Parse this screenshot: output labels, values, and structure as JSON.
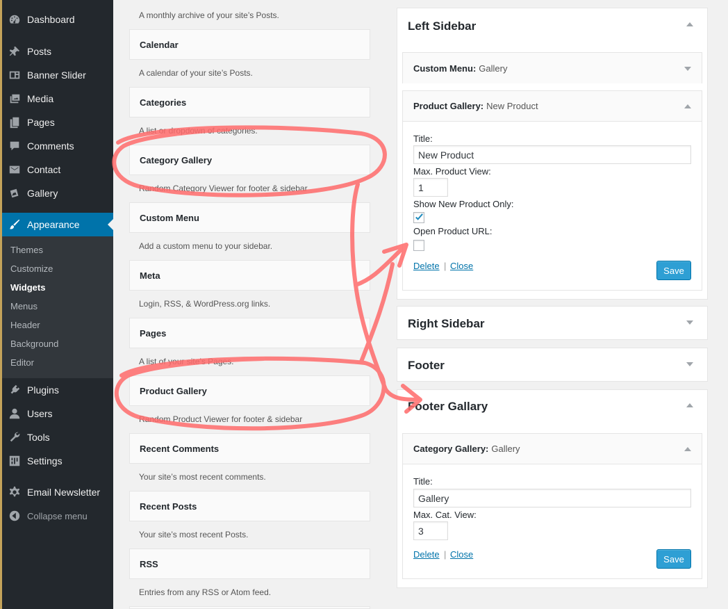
{
  "admin_menu": {
    "top_items": [
      {
        "label": "Dashboard",
        "icon": "dashboard-icon"
      },
      {
        "label": "Posts",
        "icon": "pin-icon"
      },
      {
        "label": "Banner Slider",
        "icon": "slider-icon"
      },
      {
        "label": "Media",
        "icon": "media-icon"
      },
      {
        "label": "Pages",
        "icon": "pages-icon"
      },
      {
        "label": "Comments",
        "icon": "comment-icon"
      },
      {
        "label": "Contact",
        "icon": "mail-icon"
      },
      {
        "label": "Gallery",
        "icon": "gallery-icon"
      }
    ],
    "current": {
      "label": "Appearance",
      "icon": "brush-icon"
    },
    "submenu": [
      "Themes",
      "Customize",
      "Widgets",
      "Menus",
      "Header",
      "Background",
      "Editor"
    ],
    "active_submenu": "Widgets",
    "bottom_items": [
      {
        "label": "Plugins",
        "icon": "plug-icon"
      },
      {
        "label": "Users",
        "icon": "user-icon"
      },
      {
        "label": "Tools",
        "icon": "wrench-icon"
      },
      {
        "label": "Settings",
        "icon": "settings-icon"
      }
    ],
    "extra_item": {
      "label": "Email Newsletter",
      "icon": "gear-icon"
    },
    "collapse_label": "Collapse menu",
    "accent_color": "#0073aa"
  },
  "available_widgets": {
    "first_desc": "A monthly archive of your site’s Posts.",
    "items": [
      {
        "title": "Calendar",
        "desc": "A calendar of your site’s Posts."
      },
      {
        "title": "Categories",
        "desc": "A list or dropdown of categories."
      },
      {
        "title": "Category Gallery",
        "desc": "Random Category Viewer for footer & sidebar"
      },
      {
        "title": "Custom Menu",
        "desc": "Add a custom menu to your sidebar."
      },
      {
        "title": "Meta",
        "desc": "Login, RSS, & WordPress.org links."
      },
      {
        "title": "Pages",
        "desc": "A list of your site’s Pages."
      },
      {
        "title": "Product Gallery",
        "desc": "Random Product Viewer for footer & sidebar"
      },
      {
        "title": "Recent Comments",
        "desc": "Your site’s most recent comments."
      },
      {
        "title": "Recent Posts",
        "desc": "Your site’s most recent Posts."
      },
      {
        "title": "RSS",
        "desc": "Entries from any RSS or Atom feed."
      }
    ]
  },
  "left_sidebar": {
    "title": "Left Sidebar",
    "custom_menu": {
      "name": "Custom Menu:",
      "instance": "Gallery"
    },
    "product_gallery": {
      "name": "Product Gallery:",
      "instance": "New Product",
      "title_label": "Title:",
      "title_value": "New Product",
      "max_label": "Max. Product View:",
      "max_value": "1",
      "show_new_label": "Show New Product Only:",
      "show_new_checked": true,
      "open_url_label": "Open Product URL:",
      "open_url_checked": false,
      "delete_label": "Delete",
      "separator": "|",
      "close_label": "Close",
      "save_label": "Save"
    }
  },
  "right_sidebar": {
    "title": "Right Sidebar"
  },
  "footer": {
    "title": "Footer"
  },
  "footer_gallery": {
    "title": "Footer Gallary",
    "category_gallery": {
      "name": "Category Gallery:",
      "instance": "Gallery",
      "title_label": "Title:",
      "title_value": "Gallery",
      "max_label": "Max. Cat. View:",
      "max_value": "3",
      "delete_label": "Delete",
      "separator": "|",
      "close_label": "Close",
      "save_label": "Save"
    }
  },
  "annotation_color": "#ff6b6b"
}
